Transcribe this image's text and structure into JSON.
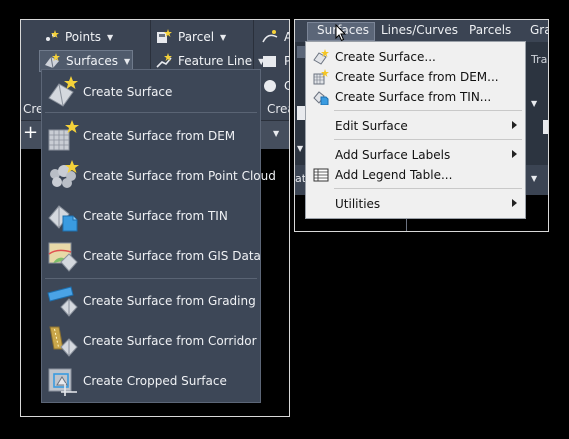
{
  "ribbon": {
    "points_label": "Points",
    "surfaces_label": "Surfaces",
    "parcel_label": "Parcel",
    "feature_line_label": "Feature Line",
    "cut_a_label": "A",
    "cut_p_label": "P",
    "cut_c_label": "C",
    "cut_cre_left": "Cre",
    "cut_crea_right": "Crea"
  },
  "surfaces_dropdown": {
    "items": [
      {
        "label": "Create Surface",
        "icon": "create-surface-icon"
      },
      {
        "label": "Create Surface from DEM",
        "icon": "surface-from-dem-icon"
      },
      {
        "label": "Create Surface from Point Cloud",
        "icon": "point-cloud-icon"
      },
      {
        "label": "Create Surface from TIN",
        "icon": "surface-from-tin-icon"
      },
      {
        "label": "Create Surface from GIS Data",
        "icon": "gis-data-icon"
      },
      {
        "label": "Create Surface from Grading",
        "icon": "grading-icon"
      },
      {
        "label": "Create Surface from Corridor",
        "icon": "corridor-icon"
      },
      {
        "label": "Create Cropped Surface",
        "icon": "cropped-surface-icon"
      }
    ]
  },
  "menubar": {
    "items": [
      "Surfaces",
      "Lines/Curves",
      "Parcels",
      "Gra"
    ],
    "active": "Surfaces",
    "cut_text_trans": "Trans",
    "cut_text_at": "at"
  },
  "surfaces_menu": {
    "items": [
      {
        "label": "Create Surface...",
        "icon": "create-surface-icon",
        "submenu": false
      },
      {
        "label": "Create Surface from DEM...",
        "icon": "surface-from-dem-icon",
        "submenu": false
      },
      {
        "label": "Create Surface from TIN...",
        "icon": "surface-from-tin-icon",
        "submenu": false
      },
      {
        "label": "Edit Surface",
        "submenu": true
      },
      {
        "label": "Add Surface Labels",
        "submenu": true
      },
      {
        "label": "Add Legend Table...",
        "icon": "legend-table-icon",
        "submenu": false
      },
      {
        "label": "Utilities",
        "submenu": true
      }
    ]
  },
  "colors": {
    "ribbon_bg": "#3b4453",
    "dropdown_bg": "#3d4757",
    "menu_bg": "#f0f0f0",
    "star_yellow": "#f5d23a",
    "tin_blue": "#3a9be0"
  }
}
